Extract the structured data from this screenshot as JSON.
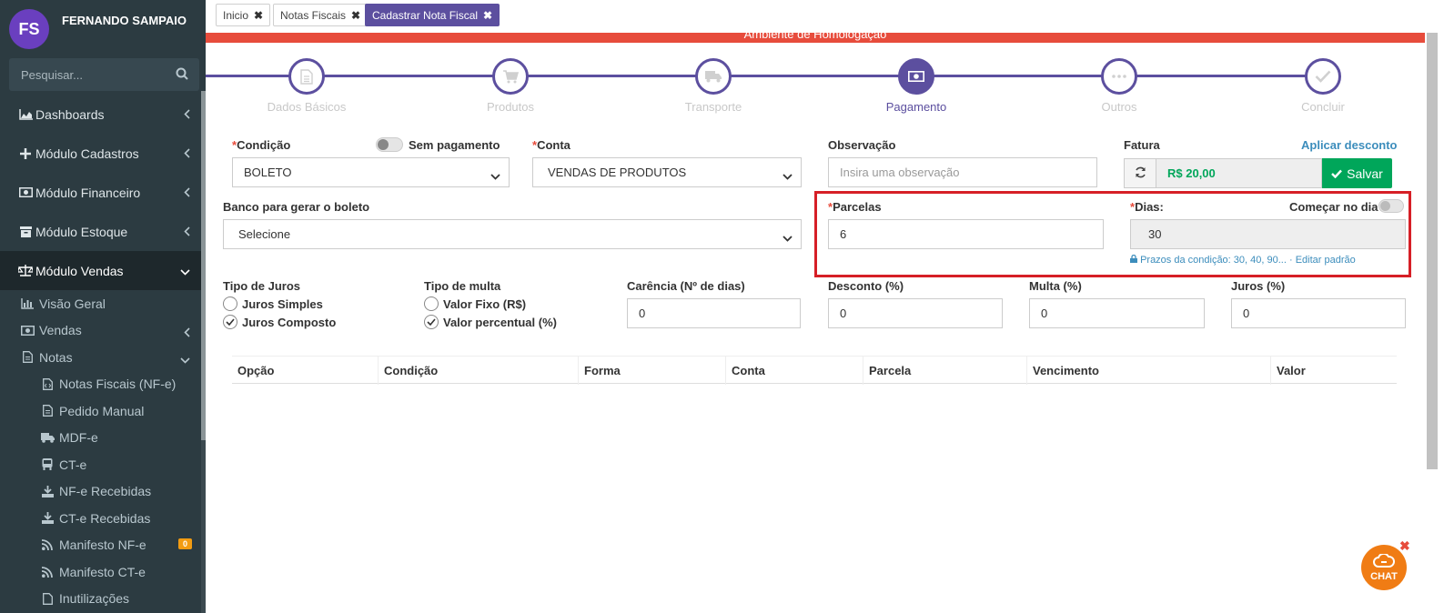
{
  "user": {
    "initials": "FS",
    "name": "FERNANDO SAMPAIO"
  },
  "sidebar": {
    "search_placeholder": "Pesquisar...",
    "menu": [
      {
        "label": "Dashboards",
        "icon": "area-chart-icon"
      },
      {
        "label": "Módulo Cadastros",
        "icon": "plus-icon"
      },
      {
        "label": "Módulo Financeiro",
        "icon": "money-icon"
      },
      {
        "label": "Módulo Estoque",
        "icon": "archive-icon"
      },
      {
        "label": "Módulo Vendas",
        "icon": "balance-scale-icon"
      }
    ],
    "vendas_sub": [
      {
        "label": "Visão Geral",
        "icon": "bar-chart-icon"
      },
      {
        "label": "Vendas",
        "icon": "money-icon"
      },
      {
        "label": "Notas",
        "icon": "file-icon"
      }
    ],
    "notas_sub": [
      {
        "label": "Notas Fiscais (NF-e)",
        "icon": "file-code-icon"
      },
      {
        "label": "Pedido Manual",
        "icon": "file-text-icon"
      },
      {
        "label": "MDF-e",
        "icon": "truck-icon"
      },
      {
        "label": "CT-e",
        "icon": "bus-icon"
      },
      {
        "label": "NF-e Recebidas",
        "icon": "download-icon"
      },
      {
        "label": "CT-e Recebidas",
        "icon": "download-icon"
      },
      {
        "label": "Manifesto NF-e",
        "icon": "rss-icon",
        "badge": "0"
      },
      {
        "label": "Manifesto CT-e",
        "icon": "rss-icon"
      },
      {
        "label": "Inutilizações",
        "icon": "file-icon"
      }
    ]
  },
  "tabs": [
    {
      "label": "Inicio"
    },
    {
      "label": "Notas Fiscais"
    },
    {
      "label": "Cadastrar Nota Fiscal"
    }
  ],
  "env_banner": "Ambiente de Homologação",
  "steps": [
    {
      "label": "Dados Básicos"
    },
    {
      "label": "Produtos"
    },
    {
      "label": "Transporte"
    },
    {
      "label": "Pagamento"
    },
    {
      "label": "Outros"
    },
    {
      "label": "Concluir"
    }
  ],
  "form": {
    "condicao_label": "Condição",
    "condicao_value": "BOLETO",
    "sem_pagamento_label": "Sem pagamento",
    "conta_label": "Conta",
    "conta_value": "VENDAS DE PRODUTOS",
    "observacao_label": "Observação",
    "observacao_placeholder": "Insira uma observação",
    "fatura_label": "Fatura",
    "aplicar_desconto": "Aplicar desconto",
    "fatura_value": "R$ 20,00",
    "salvar_label": "Salvar",
    "banco_label": "Banco para gerar o boleto",
    "banco_value": "Selecione",
    "parcelas_label": "Parcelas",
    "parcelas_value": "6",
    "dias_label": "Dias:",
    "dias_value": "30",
    "comecar_label": "Começar no dia?",
    "prazos_hint": "Prazos da condição: 30, 40, 90...",
    "editar_padrao": "Editar padrão",
    "tipo_juros_label": "Tipo de Juros",
    "juros_simples": "Juros Simples",
    "juros_composto": "Juros Composto",
    "tipo_multa_label": "Tipo de multa",
    "valor_fixo": "Valor Fixo (R$)",
    "valor_percentual": "Valor percentual (%)",
    "carencia_label": "Carência (Nº de dias)",
    "carencia_value": "0",
    "desconto_label": "Desconto (%)",
    "desconto_value": "0",
    "multa_label": "Multa (%)",
    "multa_value": "0",
    "juros_label": "Juros (%)",
    "juros_value": "0"
  },
  "table": {
    "headers": [
      "Opção",
      "Condição",
      "Forma",
      "Conta",
      "Parcela",
      "Vencimento",
      "Valor"
    ]
  },
  "chat_label": "CHAT"
}
